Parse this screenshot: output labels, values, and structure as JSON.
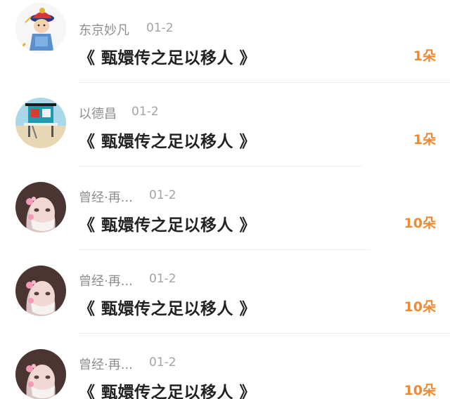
{
  "rows": [
    {
      "avatar": "qing-official-avatar-icon",
      "name": "东京妙凡",
      "date": "01-2",
      "gift": "《 甄嬛传之足以移人 》",
      "count": "1朵"
    },
    {
      "avatar": "beach-hut-avatar-icon",
      "name": "以德昌",
      "date": "01-2",
      "gift": "《 甄嬛传之足以移人 》",
      "count": "1朵"
    },
    {
      "avatar": "anime-girl-avatar-icon",
      "name": "曾经·再...",
      "date": "01-2",
      "gift": "《 甄嬛传之足以移人 》",
      "count": "10朵"
    },
    {
      "avatar": "anime-girl-avatar-icon",
      "name": "曾经·再...",
      "date": "01-2",
      "gift": "《 甄嬛传之足以移人 》",
      "count": "10朵"
    },
    {
      "avatar": "anime-girl-avatar-icon",
      "name": "曾经·再...",
      "date": "01-2",
      "gift": "《 甄嬛传之足以移人 》",
      "count": "10朵"
    }
  ],
  "colors": {
    "count": "#ef8a32",
    "name": "#8e8e8e",
    "gift": "#222222",
    "divider": "#eeeeee"
  }
}
